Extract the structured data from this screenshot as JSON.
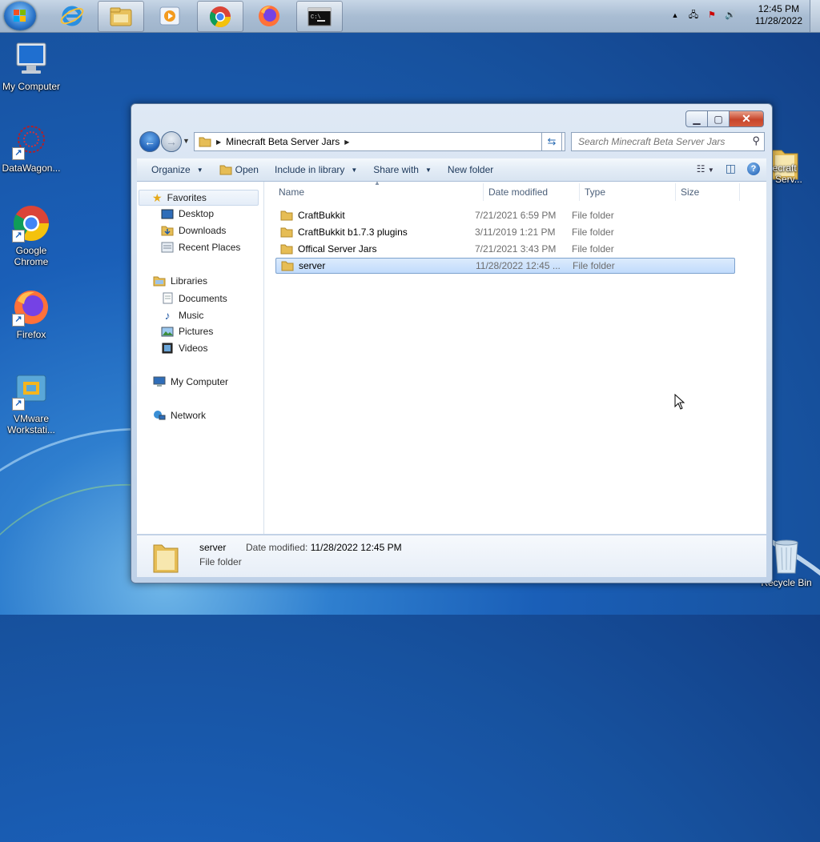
{
  "taskbar": {
    "clock_time": "12:45 PM",
    "clock_date": "11/28/2022",
    "apps": [
      "internet-explorer",
      "windows-explorer",
      "media-player",
      "chrome",
      "firefox",
      "command-prompt"
    ]
  },
  "desktop": {
    "icons": [
      {
        "label": "My Computer"
      },
      {
        "label": "DataWagon..."
      },
      {
        "label": "Google Chrome"
      },
      {
        "label": "Firefox"
      },
      {
        "label": "VMware Workstati..."
      },
      {
        "label": "necraft\na Serv..."
      },
      {
        "label": "Recycle Bin"
      }
    ]
  },
  "explorer": {
    "breadcrumb": "Minecraft Beta Server Jars",
    "search_placeholder": "Search Minecraft Beta Server Jars",
    "toolbar": {
      "organize": "Organize",
      "open": "Open",
      "include_in_library": "Include in library",
      "share_with": "Share with",
      "new_folder": "New folder"
    },
    "nav": {
      "favorites": "Favorites",
      "desktop": "Desktop",
      "downloads": "Downloads",
      "recent_places": "Recent Places",
      "libraries": "Libraries",
      "documents": "Documents",
      "music": "Music",
      "pictures": "Pictures",
      "videos": "Videos",
      "my_computer": "My Computer",
      "network": "Network"
    },
    "columns": {
      "name": "Name",
      "date_modified": "Date modified",
      "type": "Type",
      "size": "Size"
    },
    "files": [
      {
        "name": "CraftBukkit",
        "date": "7/21/2021 6:59 PM",
        "type": "File folder"
      },
      {
        "name": "CraftBukkit b1.7.3 plugins",
        "date": "3/11/2019 1:21 PM",
        "type": "File folder"
      },
      {
        "name": "Offical Server Jars",
        "date": "7/21/2021 3:43 PM",
        "type": "File folder"
      },
      {
        "name": "server",
        "date": "11/28/2022 12:45 ...",
        "type": "File folder"
      }
    ],
    "details": {
      "name": "server",
      "type": "File folder",
      "date_label": "Date modified:",
      "date_value": "11/28/2022 12:45 PM"
    }
  },
  "colors": {
    "accent": "#1a5fb8",
    "selection": "#c1dbfc",
    "close_button": "#c7452b"
  }
}
